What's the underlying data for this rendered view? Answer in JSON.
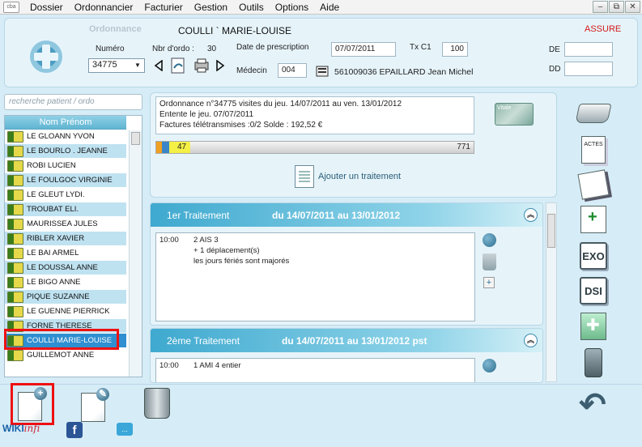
{
  "app": {
    "icon_label": "cba"
  },
  "menu": [
    "Dossier",
    "Ordonnancier",
    "Facturier",
    "Gestion",
    "Outils",
    "Options",
    "Aide"
  ],
  "window_controls": {
    "minimize": "–",
    "restore": "⧉",
    "close": "✕"
  },
  "header": {
    "ghost_label": "Ordonnance",
    "patient_name": "COULLI ` MARIE-LOUISE",
    "assure": "ASSURE",
    "numero_label": "Numéro",
    "numero_value": "34775",
    "nbr_ordo_label": "Nbr d'ordo :",
    "nbr_ordo_value": "30",
    "date_label": "Date de prescription",
    "date_value": "07/07/2011",
    "txc1_label": "Tx C1",
    "txc1_value": "100",
    "medecin_label": "Médecin",
    "medecin_code": "004",
    "medecin_value": "561009036 EPAILLARD Jean Michel",
    "de_label": "DE",
    "dd_label": "DD",
    "de_value": "",
    "dd_value": ""
  },
  "search": {
    "placeholder": "recherche patient / ordo"
  },
  "patient_list": {
    "header": "Nom Prénom",
    "rows": [
      "LE GLOANN   YVON",
      "LE BOURLO   . JEANNE",
      "ROBI   LUCIEN",
      "LE FOULGOC   VIRGINIE",
      "LE GLEUT LYDI.",
      "TROUBAT ELI.",
      "MAURISSEA   JULES",
      "RIBLER XAVIER",
      "LE BAI   ARMEL",
      "LE DOUSSAL ANNE",
      "LE BIGO   ANNE",
      "PIQUE   SUZANNE",
      "LE GUENNE   PIERRICK",
      "FORNE   THERESE",
      "COULLI   MARIE-LOUISE",
      "GUILLEMOT ANNE"
    ],
    "selected_index": 14
  },
  "info": {
    "line1": "Ordonnance n°34775    visites du jeu. 14/07/2011 au ven. 13/01/2012",
    "line2": "Entente le jeu. 07/07/2011",
    "line3": "Factures télétransmises :0/2    Solde : 192,52 €",
    "progress_left": "47",
    "progress_right": "771",
    "vitale_label": "Vitale",
    "add_treatment": "Ajouter un traitement"
  },
  "treatments": [
    {
      "title": "1er Traitement",
      "period": "du 14/07/2011 au 13/01/2012",
      "time": "10:00",
      "lines": [
        "2 AIS 3",
        "+ 1 déplacement(s)",
        "les jours fériés sont majorés"
      ]
    },
    {
      "title": "2ème Traitement",
      "period": "du 14/07/2011 au 13/01/2012 pst",
      "time": "10:00",
      "lines": [
        "1 AMI 4 entier"
      ]
    }
  ],
  "right_toolbar": {
    "actes_label": "ACTES",
    "exo_label": "EXO",
    "dsi_label": "DSI"
  },
  "bottom": {
    "wiki_label": "WIKI",
    "wiki_suffix": "infi",
    "facebook": "f",
    "chat": "..."
  }
}
